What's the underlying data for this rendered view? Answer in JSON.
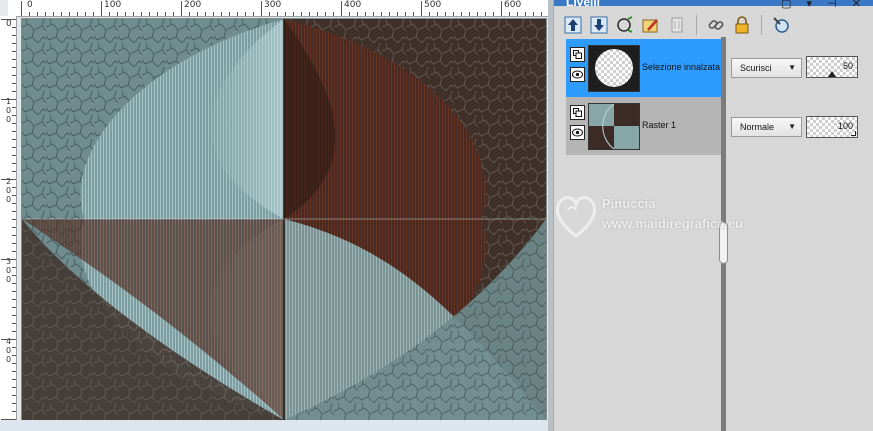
{
  "panel": {
    "title": "Livelli",
    "controls": "▢ ▾ ⊣ ✕"
  },
  "toolbar": {
    "icons": [
      "move-layer-up-icon",
      "move-layer-down-icon",
      "new-layer-icon",
      "edit-layer-icon",
      "delete-layer-icon",
      "link-layers-icon",
      "lock-layer-icon",
      "layer-properties-icon"
    ]
  },
  "layers": [
    {
      "name": "Selezione innalzata",
      "blend_mode": "Scurisci",
      "opacity": "50",
      "opacity_fraction": 0.5,
      "selected": true
    },
    {
      "name": "Raster 1",
      "blend_mode": "Normale",
      "opacity": "100",
      "opacity_fraction": 1.0,
      "selected": false
    }
  ],
  "ruler": {
    "top_labels": [
      "0",
      "100",
      "200",
      "300",
      "400",
      "500",
      "600"
    ],
    "left_labels": [
      "0",
      "100",
      "200",
      "300",
      "400"
    ]
  },
  "watermark": {
    "name": "Pinuccia",
    "url": "www.maidiregrafica.eu"
  },
  "colors": {
    "accent": "#2e9bff",
    "image_teal": "#8fb1b3",
    "image_brown": "#3b2b24",
    "image_rust": "#5a2a1e"
  }
}
